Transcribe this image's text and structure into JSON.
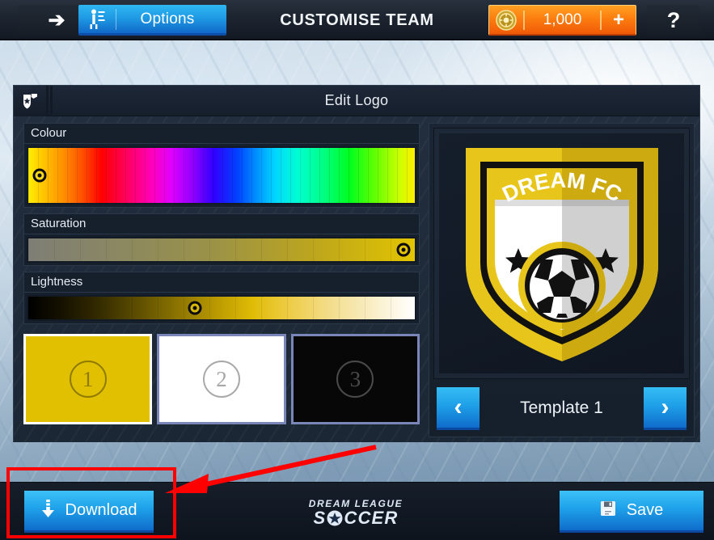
{
  "topbar": {
    "back_icon": "left-arrow-icon",
    "options_icon": "player-stats-icon",
    "options_label": "Options",
    "title": "CUSTOMISE TEAM",
    "coin_icon": "coin-icon",
    "coin_amount": "1,000",
    "coin_plus": "+",
    "help_label": "?"
  },
  "panel": {
    "icon": "shield-wrench-icon",
    "title": "Edit Logo"
  },
  "sliders": [
    {
      "label": "Colour",
      "name": "colour-slider",
      "handle_pct": 3
    },
    {
      "label": "Saturation",
      "name": "saturation-slider",
      "handle_pct": 97
    },
    {
      "label": "Lightness",
      "name": "lightness-slider",
      "handle_pct": 43
    }
  ],
  "swatches": [
    {
      "number": "1",
      "color": "#e0c000",
      "num_color": "#8f7a00",
      "selected": true
    },
    {
      "number": "2",
      "color": "#ffffff",
      "num_color": "#a8a8a8",
      "selected": false
    },
    {
      "number": "3",
      "color": "#070707",
      "num_color": "#4a4a4a",
      "selected": false
    }
  ],
  "preview": {
    "logo_text": "DREAM FC",
    "logo_colors": {
      "gold": "#e8c51a",
      "gold_dark": "#c9a711",
      "outline": "#111111",
      "panel_light": "#ffffff",
      "panel_shade": "#cfcfcf"
    },
    "prev_arrow": "‹",
    "next_arrow": "›",
    "template_label": "Template 1"
  },
  "bottombar": {
    "download_icon": "download-arrow-icon",
    "download_label": "Download",
    "save_icon": "floppy-disk-icon",
    "save_label": "Save",
    "brand_line1": "DREAM LEAGUE",
    "brand_line2a": "S",
    "brand_line2b": "CCER",
    "brand_star": "star-icon"
  },
  "annotation": {
    "highlight_color": "#ff0000",
    "rect_name": "download-highlight-rect",
    "arrow_name": "pointer-arrow"
  }
}
